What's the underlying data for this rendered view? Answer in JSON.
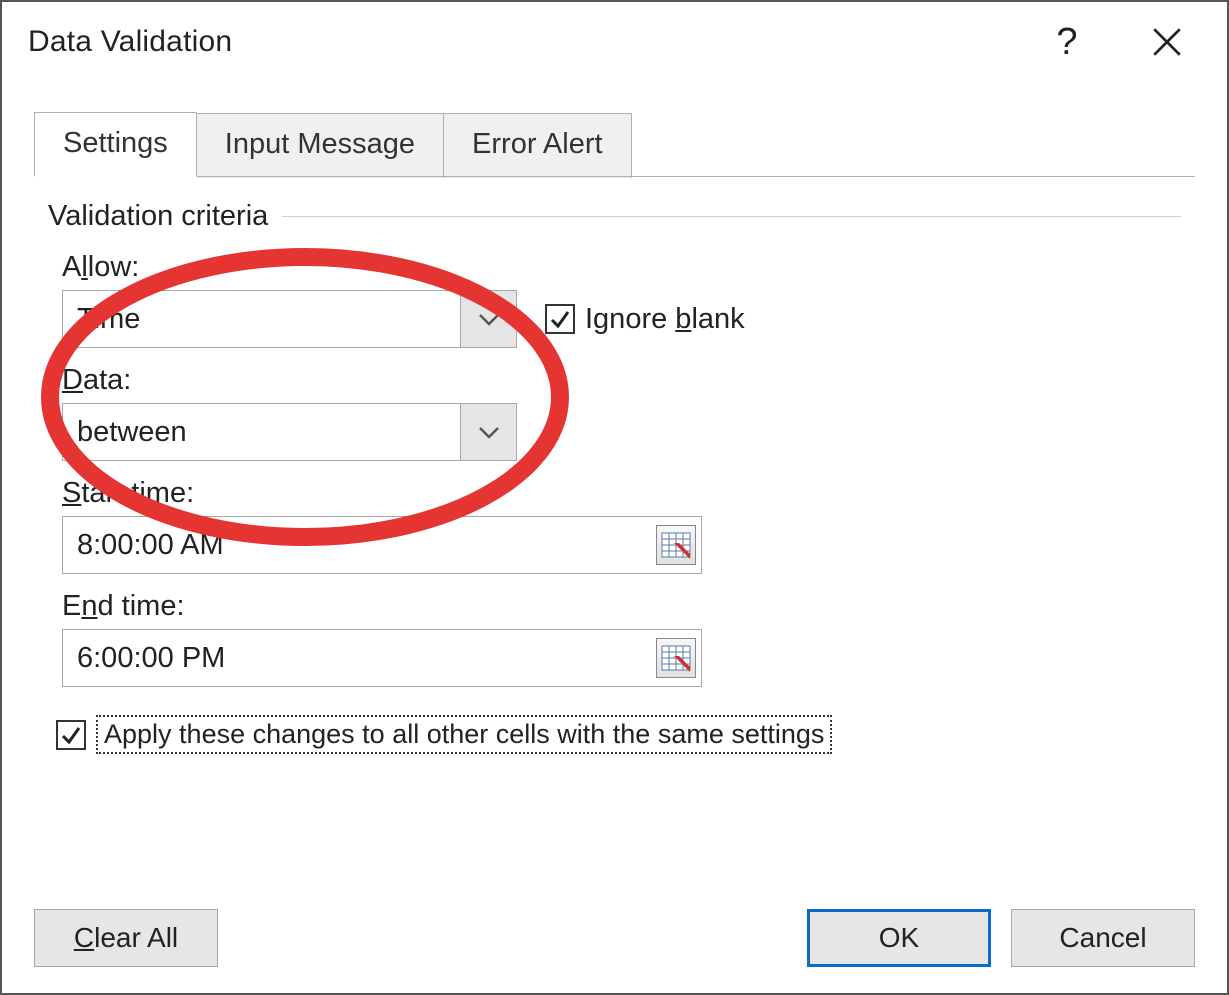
{
  "dialog": {
    "title": "Data Validation"
  },
  "tabs": {
    "settings": "Settings",
    "input_message": "Input Message",
    "error_alert": "Error Alert"
  },
  "group": {
    "title": "Validation criteria"
  },
  "fields": {
    "allow_label_pre": "A",
    "allow_label_u": "l",
    "allow_label_post": "low:",
    "allow_value": "Time",
    "ignore_pre": "Ignore ",
    "ignore_u": "b",
    "ignore_post": "lank",
    "data_label_u": "D",
    "data_label_post": "ata:",
    "data_value": "between",
    "start_label_u": "S",
    "start_label_post": "tart time:",
    "start_value": "8:00:00 AM",
    "end_label_pre": "E",
    "end_label_u": "n",
    "end_label_post": "d time:",
    "end_value": "6:00:00 PM"
  },
  "apply": {
    "label_u": "A",
    "label_post": "pply these changes to all other cells with the same settings"
  },
  "buttons": {
    "clear_u": "C",
    "clear_post": "lear All",
    "ok": "OK",
    "cancel": "Cancel"
  }
}
